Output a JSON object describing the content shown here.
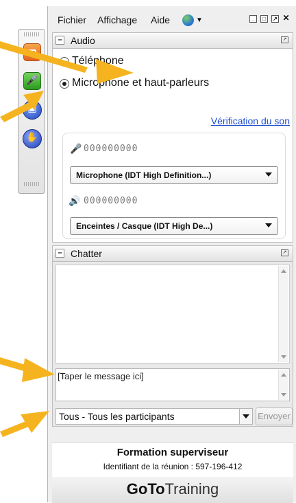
{
  "menubar": {
    "items": [
      "Fichier",
      "Affichage",
      "Aide"
    ]
  },
  "audio": {
    "title": "Audio",
    "options": [
      {
        "label": "Téléphone",
        "selected": false
      },
      {
        "label": "Microphone et haut-parleurs",
        "selected": true
      }
    ],
    "sound_check_link": "Vérification du son",
    "microphone": {
      "level": "000000000",
      "device": "Microphone (IDT High Definition...)"
    },
    "speakers": {
      "level": "000000000",
      "device": "Enceintes / Casque (IDT High De...)"
    }
  },
  "chat": {
    "title": "Chatter",
    "input_placeholder": "[Taper le message ici]",
    "recipient": "Tous - Tous les participants",
    "send_label": "Envoyer"
  },
  "footer": {
    "session_title": "Formation superviseur",
    "meeting_id": "Identifiant de la réunion : 597-196-412",
    "logo_bold": "GoTo",
    "logo_light": "Training"
  },
  "colors": {
    "annotation_arrow": "#f5b41f",
    "link": "#1a4bd1"
  }
}
